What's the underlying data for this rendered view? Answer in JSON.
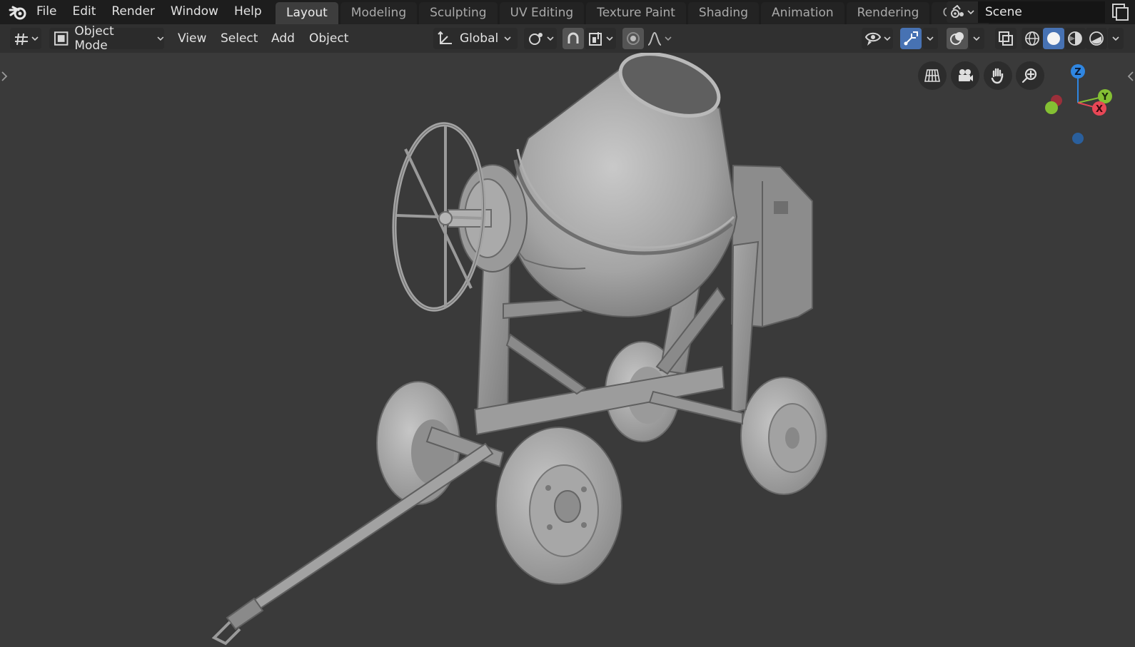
{
  "menu": {
    "items": [
      "File",
      "Edit",
      "Render",
      "Window",
      "Help"
    ]
  },
  "workspaces": {
    "active": "Layout",
    "tabs": [
      "Layout",
      "Modeling",
      "Sculpting",
      "UV Editing",
      "Texture Paint",
      "Shading",
      "Animation",
      "Rendering",
      "Compos"
    ]
  },
  "scene": {
    "name": "Scene"
  },
  "header": {
    "mode": "Object Mode",
    "view": "View",
    "select": "Select",
    "add": "Add",
    "object": "Object",
    "orientation": "Global"
  },
  "gizmo": {
    "z_label": "Z",
    "y_label": "Y",
    "x_label": "X",
    "colors": {
      "x": "#e84756",
      "y": "#84c033",
      "z": "#2f86e1"
    }
  },
  "icons": {
    "editor_type": "viewport-grid-icon",
    "mode": "object-mode-icon",
    "orientation": "transform-orientation-icon",
    "pivot": "pivot-point-icon",
    "snap": "snap-magnet-icon",
    "snap_target": "snap-increment-icon",
    "proportional": "proportional-edit-icon",
    "falloff": "falloff-curve-icon",
    "visibility": "eye-visibility-icon",
    "gizmos": "gizmo-toggle-icon",
    "overlays": "overlay-icon",
    "xray": "xray-toggle-icon",
    "nav": [
      "perspective-grid-icon",
      "camera-view-icon",
      "pan-hand-icon",
      "zoom-icon"
    ]
  },
  "colors": {
    "accent": "#4772b3",
    "viewport_bg": "#3a3a3a",
    "topbar_bg": "#1d1d1d"
  }
}
